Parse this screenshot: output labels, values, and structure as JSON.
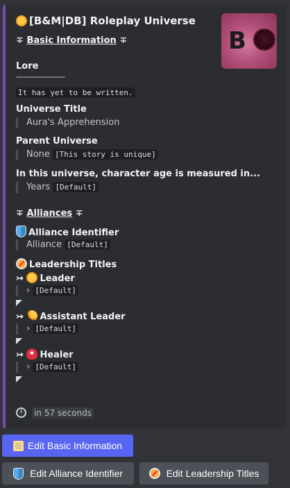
{
  "embed": {
    "accent_color": "#7c4ba8",
    "thumbnail_letter": "B",
    "title": "[B&M|DB] Roleplay Universe",
    "basic_section": {
      "prefix": "∓",
      "label": "Basic Information",
      "suffix": "∓"
    },
    "lore": {
      "label": "Lore",
      "divider": "———————",
      "value": "It has yet to be written."
    },
    "universe_title": {
      "label": "Universe Title",
      "value": "Aura's Apprehension"
    },
    "parent_universe": {
      "label": "Parent Universe",
      "value": "None",
      "note": "[This story is unique]"
    },
    "age": {
      "label": "In this universe, character age is measured in...",
      "value": "Years",
      "note": "[Default]"
    },
    "alliances_section": {
      "prefix": "∓",
      "label": "Alliances",
      "suffix": "∓"
    },
    "alliance_identifier": {
      "label": "Alliance Identifier",
      "value": "Alliance",
      "note": "[Default]"
    },
    "leadership_titles": {
      "label": "Leadership Titles",
      "arrow": "↣",
      "entries": [
        {
          "icon": "sun-icon",
          "name": "Leader",
          "bullet": "›",
          "value": "[Default]"
        },
        {
          "icon": "dizzy-icon",
          "name": "Assistant Leader",
          "bullet": "›",
          "value": "[Default]"
        },
        {
          "icon": "rescue-helmet-icon",
          "name": "Healer",
          "bullet": "›",
          "value": "[Default]"
        }
      ]
    },
    "timestamp": "in 57 seconds"
  },
  "buttons": {
    "edit_basic": "Edit Basic Information",
    "edit_alliance": "Edit Alliance Identifier",
    "edit_leadership": "Edit Leadership Titles"
  },
  "colors": {
    "primary_button": "#5865f2",
    "secondary_button": "#4e5058",
    "background": "#313338",
    "embed": "#2b2d31"
  }
}
